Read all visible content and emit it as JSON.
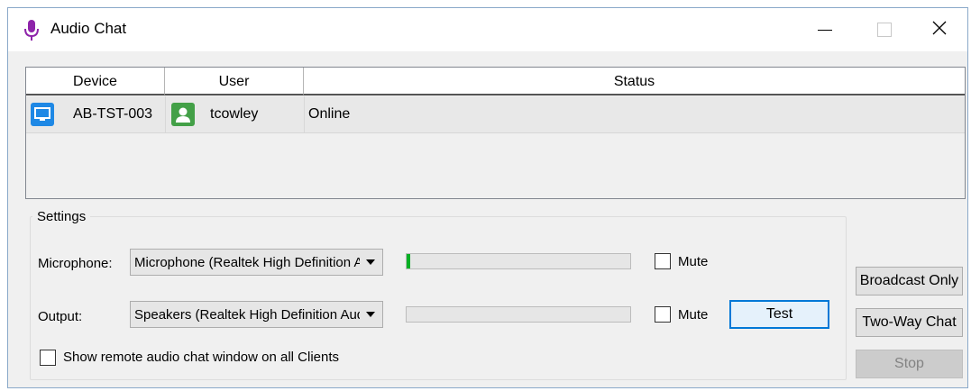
{
  "window": {
    "title": "Audio Chat",
    "title_icon": "microphone-icon",
    "controls": [
      "minimize-icon",
      "maximize-icon",
      "close-icon"
    ]
  },
  "table": {
    "columns": [
      "Device",
      "User",
      "Status"
    ],
    "rows": [
      {
        "device": "AB-TST-003",
        "device_icon": "monitor-icon",
        "user": "tcowley",
        "user_icon": "user-icon",
        "status": "Online"
      }
    ]
  },
  "settings": {
    "group_label": "Settings",
    "microphone": {
      "label": "Microphone:",
      "selected": "Microphone (Realtek High Definition Audio)",
      "level": 0.015,
      "mute_label": "Mute",
      "mute_checked": false
    },
    "output": {
      "label": "Output:",
      "selected": "Speakers (Realtek High Definition Audio)",
      "level": 0,
      "mute_label": "Mute",
      "mute_checked": false,
      "test_label": "Test"
    },
    "show_remote_label": "Show remote audio chat window on all Clients",
    "show_remote_checked": false
  },
  "actions": {
    "broadcast_only": "Broadcast Only",
    "two_way_chat": "Two-Way Chat",
    "stop": "Stop"
  },
  "colors": {
    "accent": "#0078d7",
    "meter_fill": "#06b025",
    "device_icon_bg": "#1e88e5",
    "user_icon_bg": "#43a047",
    "title_icon": "#8e24aa"
  }
}
